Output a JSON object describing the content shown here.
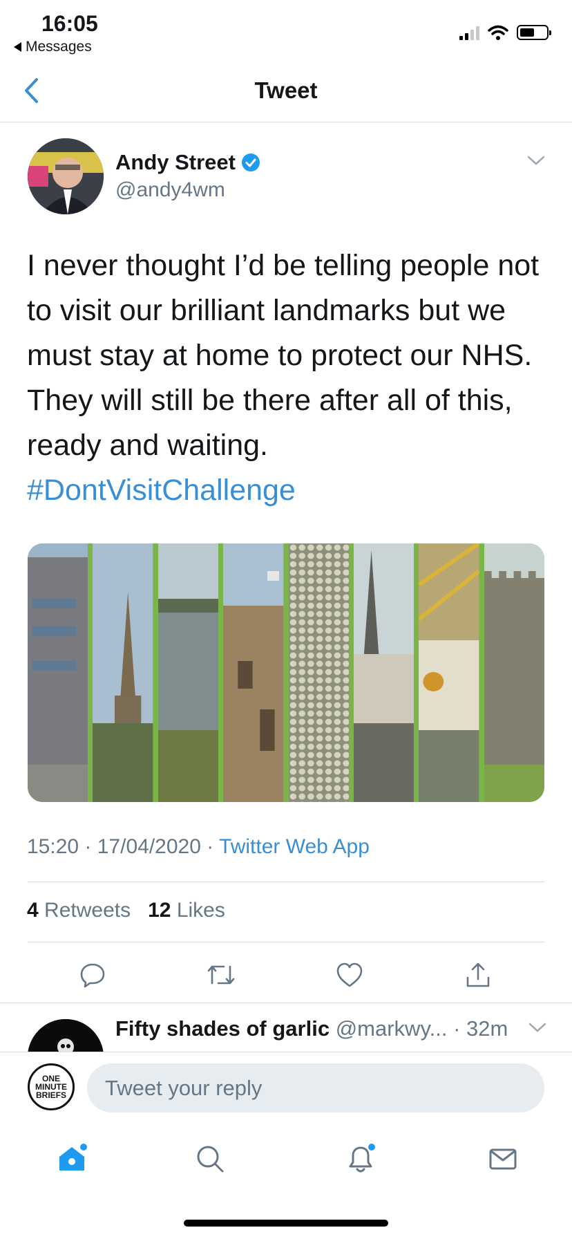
{
  "status_bar": {
    "time": "16:05",
    "back_label": "Messages"
  },
  "nav": {
    "title": "Tweet"
  },
  "tweet": {
    "author_name": "Andy Street",
    "handle": "@andy4wm",
    "text": "I never thought I’d be telling people not to visit our brilliant landmarks but we must stay at home to protect our NHS. They will still be there after all of this, ready and waiting.",
    "hashtag": "#DontVisitChallenge",
    "time": "15:20",
    "date": "17/04/2020",
    "source": "Twitter Web App",
    "retweets_count": "4",
    "retweets_label": "Retweets",
    "likes_count": "12",
    "likes_label": "Likes"
  },
  "reply_preview": {
    "name": "Fifty shades of garlic",
    "handle": "@markwy...",
    "age": "32m"
  },
  "compose": {
    "placeholder": "Tweet your reply",
    "avatar_text": "ONE MINUTE BRIEFS"
  },
  "colors": {
    "accent": "#3a8fd4",
    "muted": "#657786",
    "divider": "#d8dde2",
    "verified": "#1d9bf0"
  },
  "icons": {
    "actions": [
      "reply-icon",
      "retweet-icon",
      "like-icon",
      "share-icon"
    ],
    "tabs": [
      "home-icon",
      "search-icon",
      "notifications-icon",
      "messages-icon"
    ]
  }
}
